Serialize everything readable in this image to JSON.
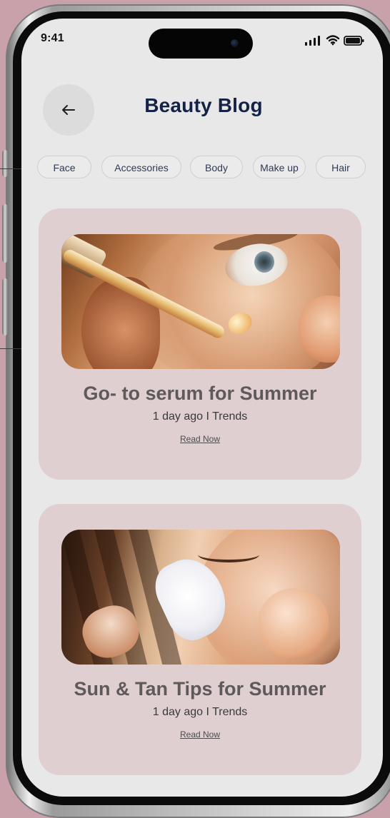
{
  "status_bar": {
    "time": "9:41"
  },
  "header": {
    "title": "Beauty Blog"
  },
  "categories": [
    {
      "label": "Face"
    },
    {
      "label": "Accessories"
    },
    {
      "label": "Body"
    },
    {
      "label": "Make up"
    },
    {
      "label": "Hair"
    }
  ],
  "posts": [
    {
      "title": "Go- to serum for Summer",
      "meta": "1 day ago I Trends",
      "link": "Read Now"
    },
    {
      "title": "Sun & Tan Tips for Summer",
      "meta": "1 day ago I Trends",
      "link": "Read Now"
    }
  ],
  "icons": {
    "back": "arrow-left-icon",
    "signal": "signal-icon",
    "wifi": "wifi-icon",
    "battery": "battery-icon"
  },
  "colors": {
    "page_background": "#c9a1aa",
    "screen_background": "#e8e8e8",
    "title": "#142345",
    "card_background": "#dfcfd1",
    "pill_background": "#ebebeb"
  }
}
